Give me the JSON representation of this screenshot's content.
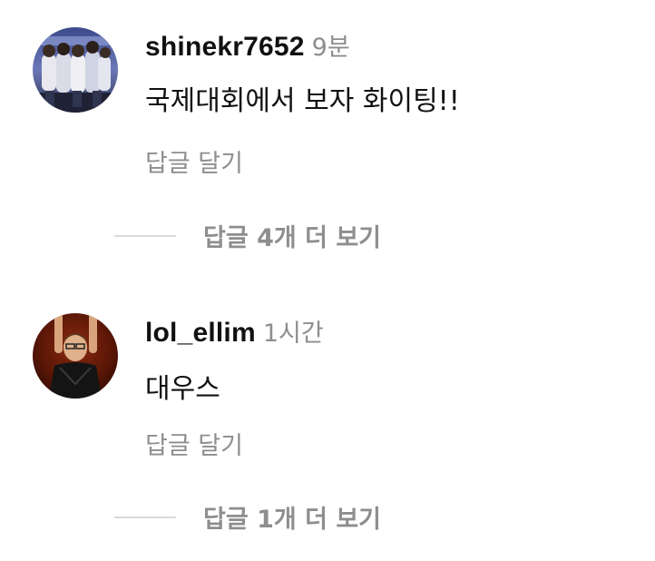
{
  "comments": [
    {
      "username": "shinekr7652",
      "time": "9분",
      "text": "국제대회에서 보자 화이팅!!",
      "reply_label": "답글 달기",
      "more_label": "답글 4개 더 보기",
      "avatar": "team-photo-avatar"
    },
    {
      "username": "lol_ellim",
      "time": "1시간",
      "text": "대우스",
      "reply_label": "답글 달기",
      "more_label": "답글 1개 더 보기",
      "avatar": "person-arms-raised-avatar"
    }
  ],
  "colors": {
    "text": "#111111",
    "secondary": "#8e8e8e",
    "divider": "#dbdbdb",
    "background": "#ffffff"
  }
}
